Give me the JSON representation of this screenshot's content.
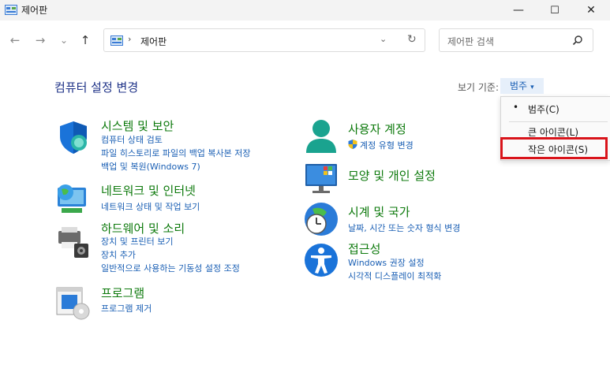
{
  "window": {
    "title": "제어판",
    "minimize": "—",
    "maximize": "☐",
    "close": "✕"
  },
  "nav": {
    "back": "←",
    "forward": "→",
    "recent": "⌄",
    "up": "↑",
    "breadcrumb_sep": "›",
    "address": "제어판",
    "dropdown": "⌄",
    "refresh": "↻",
    "search_placeholder": "제어판 검색"
  },
  "main": {
    "title": "컴퓨터 설정 변경",
    "view_by_label": "보기 기준:",
    "view_by_value": "범주",
    "view_by_caret": "▾"
  },
  "view_menu": {
    "items": [
      {
        "label": "범주(C)",
        "bullet": "•"
      },
      {
        "label": "큰 아이콘(L)"
      },
      {
        "label": "작은 아이콘(S)"
      }
    ]
  },
  "categories": {
    "left": [
      {
        "title": "시스템 및 보안",
        "links": [
          "컴퓨터 상태 검토",
          "파일 히스토리로 파일의 백업 복사본 저장",
          "백업 및 복원(Windows 7)"
        ]
      },
      {
        "title": "네트워크 및 인터넷",
        "links": [
          "네트워크 상태 및 작업 보기"
        ]
      },
      {
        "title": "하드웨어 및 소리",
        "links": [
          "장치 및 프린터 보기",
          "장치 추가",
          "일반적으로 사용하는 기동성 설정 조정"
        ]
      },
      {
        "title": "프로그램",
        "links": [
          "프로그램 제거"
        ]
      }
    ],
    "right": [
      {
        "title": "사용자 계정",
        "links": [
          "계정 유형 변경"
        ]
      },
      {
        "title": "모양 및 개인 설정",
        "links": []
      },
      {
        "title": "시계 및 국가",
        "links": [
          "날짜, 시간 또는 숫자 형식 변경"
        ]
      },
      {
        "title": "접근성",
        "links": [
          "Windows 권장 설정",
          "시각적 디스플레이 최적화"
        ]
      }
    ]
  }
}
